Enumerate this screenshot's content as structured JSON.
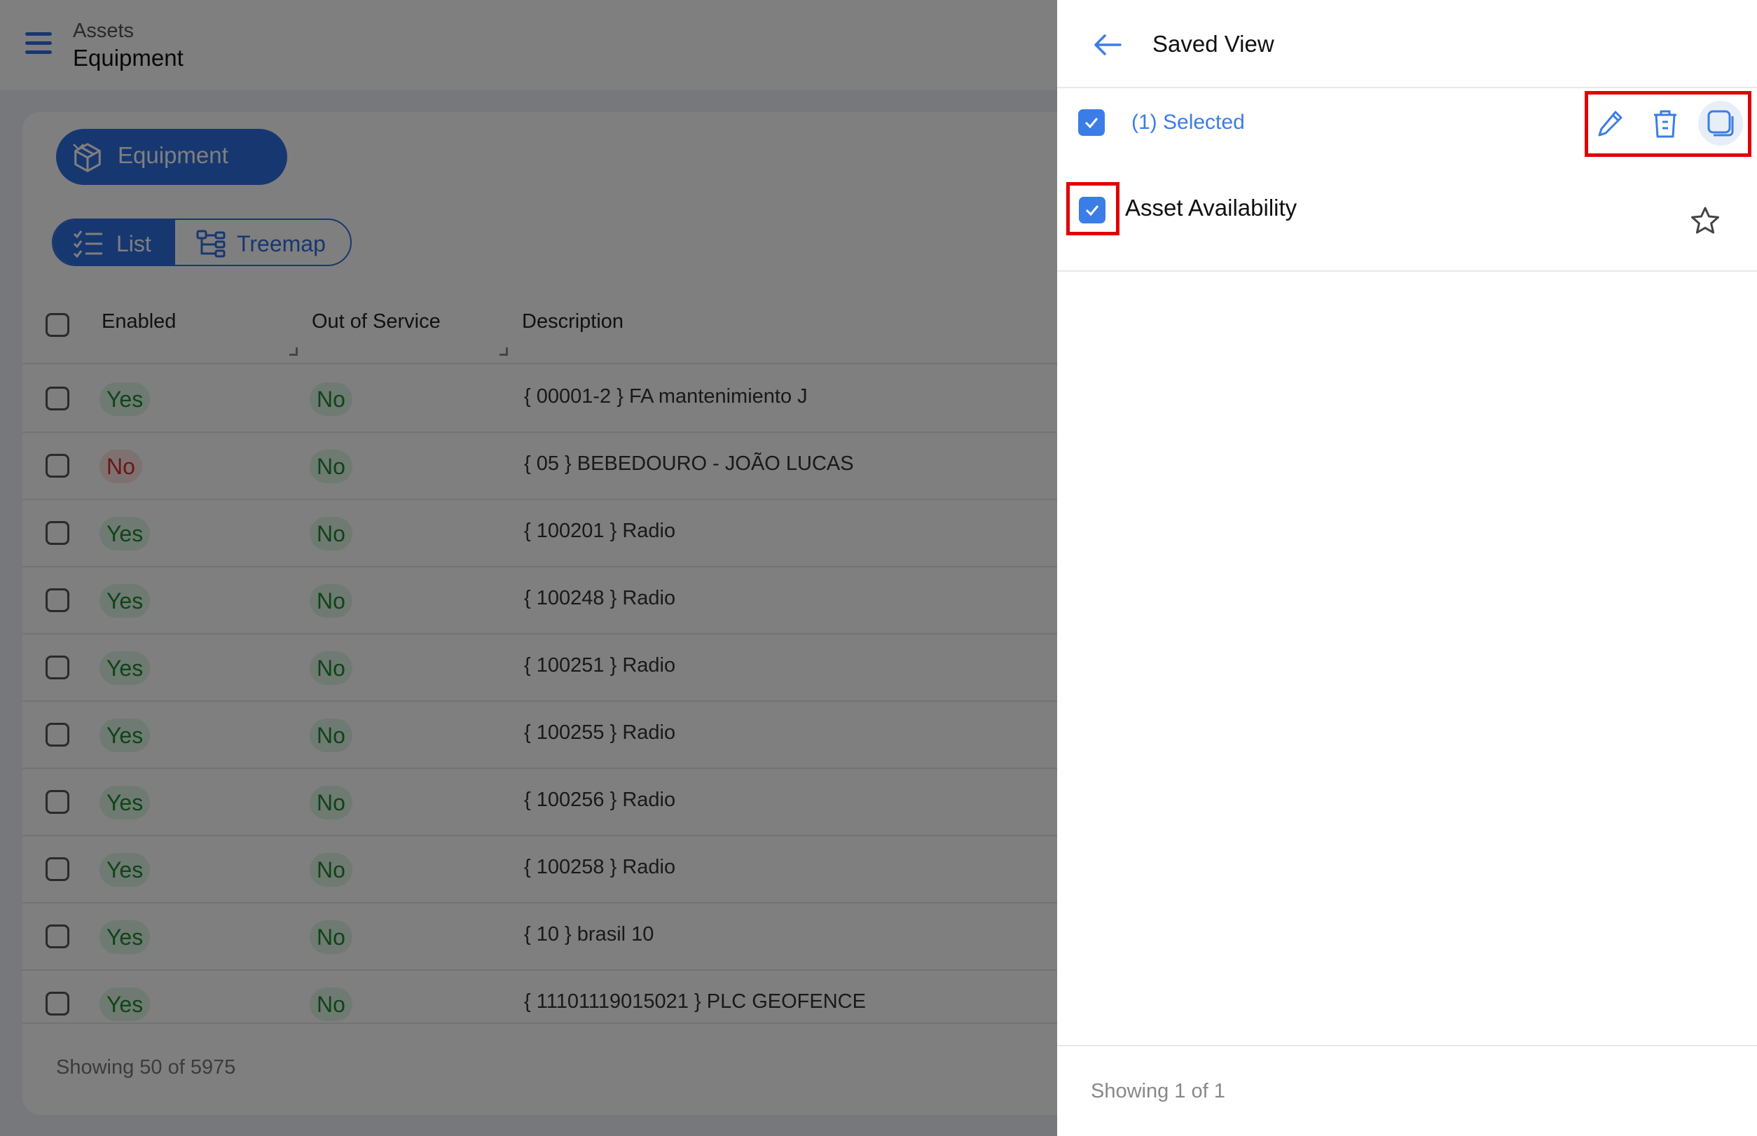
{
  "header": {
    "breadcrumb_parent": "Assets",
    "breadcrumb_current": "Equipment"
  },
  "toolbar": {
    "entity_button_label": "Equipment",
    "view_tabs": [
      {
        "label": "List",
        "active": true
      },
      {
        "label": "Treemap",
        "active": false
      }
    ]
  },
  "table": {
    "columns": [
      "Enabled",
      "Out of Service",
      "Description"
    ],
    "rows": [
      {
        "enabled": "Yes",
        "out_of_service": "No",
        "description": "{ 00001-2 } FA mantenimiento J"
      },
      {
        "enabled": "No",
        "out_of_service": "No",
        "description": "{ 05 } BEBEDOURO - JOÃO LUCAS"
      },
      {
        "enabled": "Yes",
        "out_of_service": "No",
        "description": "{ 100201 } Radio"
      },
      {
        "enabled": "Yes",
        "out_of_service": "No",
        "description": "{ 100248 } Radio"
      },
      {
        "enabled": "Yes",
        "out_of_service": "No",
        "description": "{ 100251 } Radio"
      },
      {
        "enabled": "Yes",
        "out_of_service": "No",
        "description": "{ 100255 } Radio"
      },
      {
        "enabled": "Yes",
        "out_of_service": "No",
        "description": "{ 100256 } Radio"
      },
      {
        "enabled": "Yes",
        "out_of_service": "No",
        "description": "{ 100258 } Radio"
      },
      {
        "enabled": "Yes",
        "out_of_service": "No",
        "description": "{ 10 } brasil 10"
      },
      {
        "enabled": "Yes",
        "out_of_service": "No",
        "description": "{ 11101119015021 } PLC GEOFENCE"
      }
    ],
    "footer": "Showing 50 of 5975"
  },
  "drawer": {
    "title": "Saved View",
    "selected_text": "(1) Selected",
    "actions": [
      "edit-icon",
      "trash-icon",
      "copy-icon"
    ],
    "items": [
      {
        "label": "Asset Availability",
        "checked": true,
        "favorite": false
      }
    ],
    "footer": "Showing 1 of 1"
  },
  "colors": {
    "accent": "#2f6fe0",
    "yes_green": "#1c8a33",
    "no_red": "#d32f2f",
    "highlight_box": "#e00000"
  }
}
